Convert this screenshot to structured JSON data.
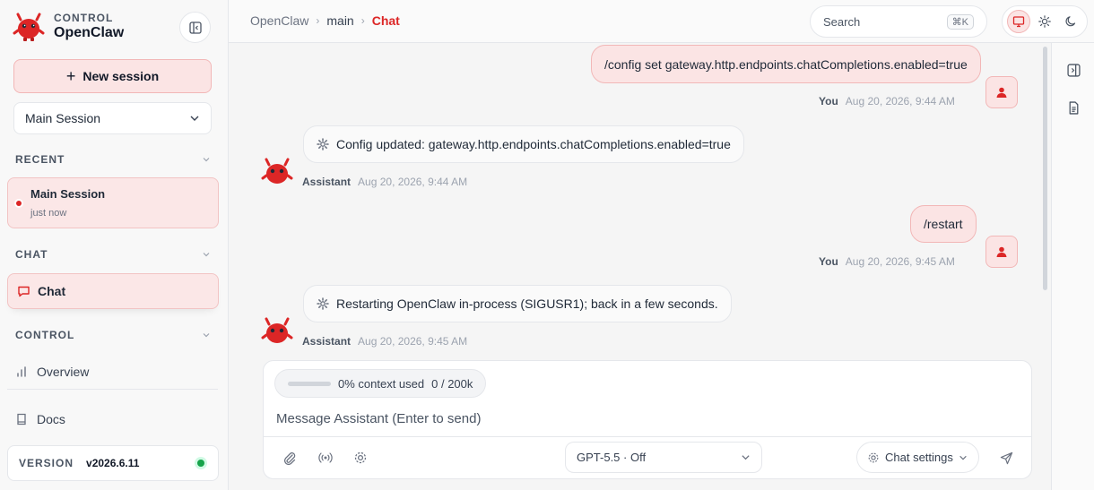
{
  "brand": {
    "kicker": "CONTROL",
    "name": "OpenClaw"
  },
  "sidebar": {
    "new_session_label": "New session",
    "session_select": "Main Session",
    "recent_heading": "RECENT",
    "recent_items": [
      {
        "title": "Main Session",
        "time": "just now"
      }
    ],
    "chat_heading": "CHAT",
    "chat_item": "Chat",
    "control_heading": "CONTROL",
    "overview_label": "Overview",
    "docs_label": "Docs",
    "version_label": "VERSION",
    "version_value": "v2026.6.11",
    "status_color": "#16a34a"
  },
  "topbar": {
    "breadcrumb": [
      "OpenClaw",
      "main",
      "Chat"
    ],
    "search_placeholder": "Search",
    "search_shortcut": "⌘K",
    "theme_modes": [
      "monitor-icon",
      "sun-icon",
      "moon-icon"
    ],
    "active_theme": "monitor"
  },
  "messages": [
    {
      "role": "user",
      "author": "You",
      "text": "/config set gateway.http.endpoints.chatCompletions.enabled=true",
      "time": "Aug 20, 2026, 9:44 AM"
    },
    {
      "role": "assistant",
      "author": "Assistant",
      "text": "Config updated: gateway.http.endpoints.chatCompletions.enabled=true",
      "time": "Aug 20, 2026, 9:44 AM"
    },
    {
      "role": "user",
      "author": "You",
      "text": "/restart",
      "time": "Aug 20, 2026, 9:45 AM"
    },
    {
      "role": "assistant",
      "author": "Assistant",
      "text": "Restarting OpenClaw in-process (SIGUSR1); back in a few seconds.",
      "time": "Aug 20, 2026, 9:45 AM"
    }
  ],
  "composer": {
    "context_label": "0% context used",
    "context_count": "0 / 200k",
    "context_fraction": 0,
    "placeholder": "Message Assistant (Enter to send)",
    "model": "GPT-5.5 · Off",
    "chat_settings_label": "Chat settings"
  },
  "colors": {
    "accent": "#dc2626",
    "accent_bg": "#fbe4e4"
  }
}
